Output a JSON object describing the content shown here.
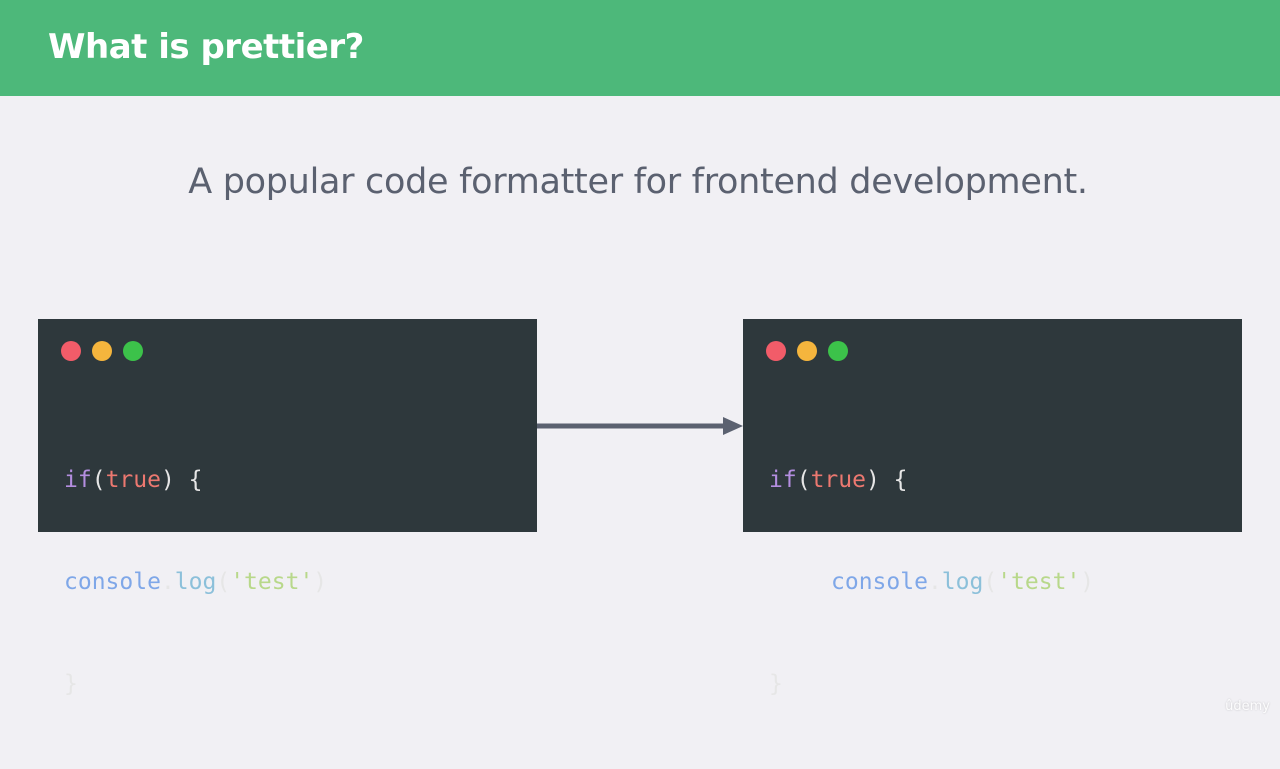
{
  "header": {
    "title": "What is prettier?",
    "background_color": "#4db87a"
  },
  "subtitle": "A popular code formatter for frontend development.",
  "code_before": {
    "line1": {
      "kw": "if",
      "open": "(",
      "bool": "true",
      "close": ") {"
    },
    "line2": {
      "obj": "console",
      "dot": ".",
      "method": "log",
      "open": "(",
      "str": "'test'",
      "close": ")"
    },
    "line3": "}"
  },
  "code_after": {
    "line1": {
      "kw": "if",
      "open": "(",
      "bool": "true",
      "close": ") {"
    },
    "line2": {
      "obj": "console",
      "dot": ".",
      "method": "log",
      "open": "(",
      "str": "'test'",
      "close": ")"
    },
    "line3": "}"
  },
  "window_controls": {
    "red": "#f25c69",
    "yellow": "#f5b53d",
    "green": "#3cc24a"
  },
  "arrow": {
    "icon": "right-arrow-icon",
    "color": "#5b6170"
  },
  "watermark": "ûdemy"
}
